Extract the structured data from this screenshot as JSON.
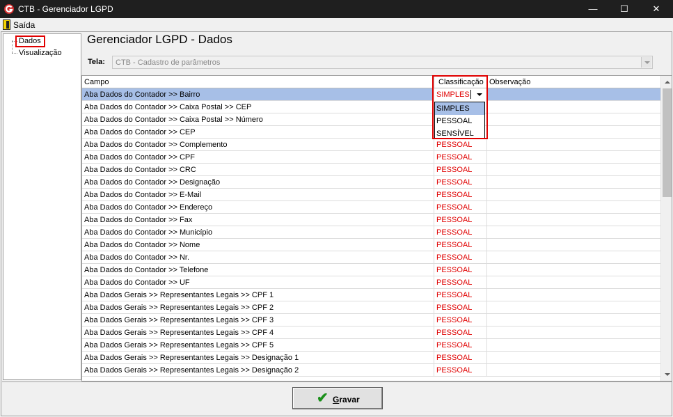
{
  "window": {
    "title": "CTB - Gerenciador LGPD",
    "minimize_glyph": "—",
    "maximize_glyph": "☐",
    "close_glyph": "✕"
  },
  "menu": {
    "exit_label": "Saída",
    "exit_icon": "door-exit-icon"
  },
  "tree": {
    "items": [
      {
        "label": "Dados",
        "selected": true
      },
      {
        "label": "Visualização",
        "selected": false
      }
    ]
  },
  "page": {
    "title": "Gerenciador LGPD - Dados",
    "tela_label": "Tela:",
    "tela_value": "CTB - Cadastro de parâmetros"
  },
  "grid": {
    "columns": {
      "campo": "Campo",
      "classificacao": "Classificação",
      "observacao": "Observação"
    },
    "rows": [
      {
        "campo": "Aba Dados do Contador >> Bairro",
        "classificacao": "SIMPLES"
      },
      {
        "campo": "Aba Dados do Contador >> Caixa Postal >> CEP",
        "classificacao": ""
      },
      {
        "campo": "Aba Dados do Contador >> Caixa Postal >> Número",
        "classificacao": ""
      },
      {
        "campo": "Aba Dados do Contador >> CEP",
        "classificacao": ""
      },
      {
        "campo": "Aba Dados do Contador >> Complemento",
        "classificacao": "PESSOAL"
      },
      {
        "campo": "Aba Dados do Contador >> CPF",
        "classificacao": "PESSOAL"
      },
      {
        "campo": "Aba Dados do Contador >> CRC",
        "classificacao": "PESSOAL"
      },
      {
        "campo": "Aba Dados do Contador >> Designação",
        "classificacao": "PESSOAL"
      },
      {
        "campo": "Aba Dados do Contador >> E-Mail",
        "classificacao": "PESSOAL"
      },
      {
        "campo": "Aba Dados do Contador >> Endereço",
        "classificacao": "PESSOAL"
      },
      {
        "campo": "Aba Dados do Contador >> Fax",
        "classificacao": "PESSOAL"
      },
      {
        "campo": "Aba Dados do Contador >> Município",
        "classificacao": "PESSOAL"
      },
      {
        "campo": "Aba Dados do Contador >> Nome",
        "classificacao": "PESSOAL"
      },
      {
        "campo": "Aba Dados do Contador >> Nr.",
        "classificacao": "PESSOAL"
      },
      {
        "campo": "Aba Dados do Contador >> Telefone",
        "classificacao": "PESSOAL"
      },
      {
        "campo": "Aba Dados do Contador >> UF",
        "classificacao": "PESSOAL"
      },
      {
        "campo": "Aba Dados Gerais >> Representantes Legais >> CPF 1",
        "classificacao": "PESSOAL"
      },
      {
        "campo": "Aba Dados Gerais >> Representantes Legais >> CPF 2",
        "classificacao": "PESSOAL"
      },
      {
        "campo": "Aba Dados Gerais >> Representantes Legais >> CPF 3",
        "classificacao": "PESSOAL"
      },
      {
        "campo": "Aba Dados Gerais >> Representantes Legais >> CPF 4",
        "classificacao": "PESSOAL"
      },
      {
        "campo": "Aba Dados Gerais >> Representantes Legais >> CPF 5",
        "classificacao": "PESSOAL"
      },
      {
        "campo": "Aba Dados Gerais >> Representantes Legais >> Designação 1",
        "classificacao": "PESSOAL"
      },
      {
        "campo": "Aba Dados Gerais >> Representantes Legais >> Designação 2",
        "classificacao": "PESSOAL"
      }
    ],
    "dropdown_options": [
      "SIMPLES",
      "PESSOAL",
      "SENSÍVEL"
    ],
    "dropdown_active": "SIMPLES"
  },
  "footer": {
    "save_label_first": "G",
    "save_label_rest": "ravar",
    "save_icon": "check-icon"
  },
  "colors": {
    "titlebar": "#1f1f1f",
    "selection": "#a7bfe7",
    "classification_text": "#e00000",
    "highlight_box": "#e00000",
    "save_check": "#1a8f1a"
  }
}
